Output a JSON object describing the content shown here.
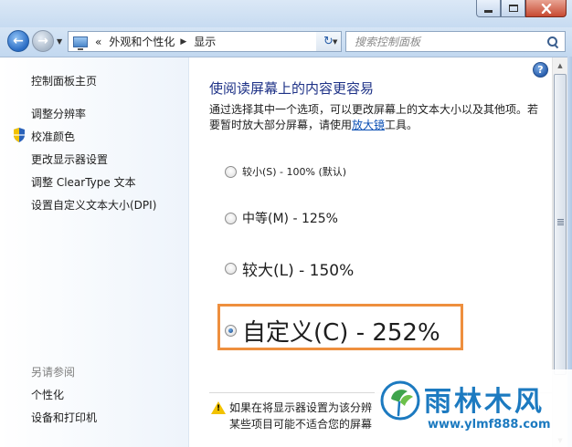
{
  "nav": {
    "address_prefix": "«",
    "address_segment_1": "外观和个性化",
    "address_segment_2": "显示",
    "search_placeholder": "搜索控制面板"
  },
  "sidebar": {
    "home": "控制面板主页",
    "items": [
      {
        "label": "调整分辨率"
      },
      {
        "label": "校准颜色"
      },
      {
        "label": "更改显示器设置"
      },
      {
        "label": "调整 ClearType 文本"
      },
      {
        "label": "设置自定义文本大小(DPI)"
      }
    ],
    "see_also_heading": "另请参阅",
    "see_also": [
      {
        "label": "个性化"
      },
      {
        "label": "设备和打印机"
      }
    ]
  },
  "content": {
    "title": "使阅读屏幕上的内容更容易",
    "description_before": "通过选择其中一个选项，可以更改屏幕上的文本大小以及其他项。若要暂时放大部分屏幕，请使用",
    "magnifier_link": "放大镜",
    "description_after": "工具。",
    "options": [
      {
        "label": "较小(S) - 100% (默认)",
        "checked": false
      },
      {
        "label": "中等(M) - 125%",
        "checked": false
      },
      {
        "label": "较大(L) - 150%",
        "checked": false
      },
      {
        "label": "自定义(C) - 252%",
        "checked": true
      }
    ],
    "warning_line_1": "如果在将显示器设置为该分辨",
    "warning_line_2": "某些项目可能不适合您的屏幕"
  },
  "watermark": {
    "name": "雨林木风",
    "url": "www.ylmf888.com"
  },
  "colors": {
    "title": "#1e3287",
    "link": "#0a4fb4",
    "highlight": "#ee8f3e",
    "watermark": "#1c7ac0"
  }
}
